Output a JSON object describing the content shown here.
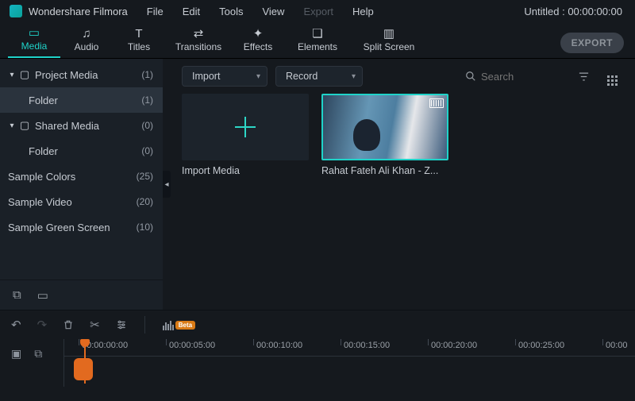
{
  "app": {
    "title": "Wondershare Filmora",
    "project_title": "Untitled : 00:00:00:00"
  },
  "menu": {
    "file": "File",
    "edit": "Edit",
    "tools": "Tools",
    "view": "View",
    "export": "Export",
    "help": "Help"
  },
  "tabs": {
    "media": "Media",
    "audio": "Audio",
    "titles": "Titles",
    "transitions": "Transitions",
    "effects": "Effects",
    "elements": "Elements",
    "split_screen": "Split Screen"
  },
  "export_button": "EXPORT",
  "sidebar": {
    "items": [
      {
        "name": "Project Media",
        "count": "(1)",
        "has_chevron": true,
        "has_folder": true,
        "indent": 0
      },
      {
        "name": "Folder",
        "count": "(1)",
        "has_chevron": false,
        "has_folder": false,
        "indent": 1,
        "selected": true
      },
      {
        "name": "Shared Media",
        "count": "(0)",
        "has_chevron": true,
        "has_folder": true,
        "indent": 0
      },
      {
        "name": "Folder",
        "count": "(0)",
        "has_chevron": false,
        "has_folder": false,
        "indent": 1
      },
      {
        "name": "Sample Colors",
        "count": "(25)",
        "flat": true
      },
      {
        "name": "Sample Video",
        "count": "(20)",
        "flat": true
      },
      {
        "name": "Sample Green Screen",
        "count": "(10)",
        "flat": true
      }
    ]
  },
  "toolbar": {
    "import_label": "Import",
    "record_label": "Record",
    "search_placeholder": "Search"
  },
  "media": {
    "import_card_label": "Import Media",
    "clips": [
      {
        "caption": "Rahat Fateh Ali Khan - Z..."
      }
    ]
  },
  "audio_beta_label": "Beta",
  "timeline": {
    "marks": [
      "00:00:00:00",
      "00:00:05:00",
      "00:00:10:00",
      "00:00:15:00",
      "00:00:20:00",
      "00:00:25:00",
      "00:00"
    ]
  }
}
